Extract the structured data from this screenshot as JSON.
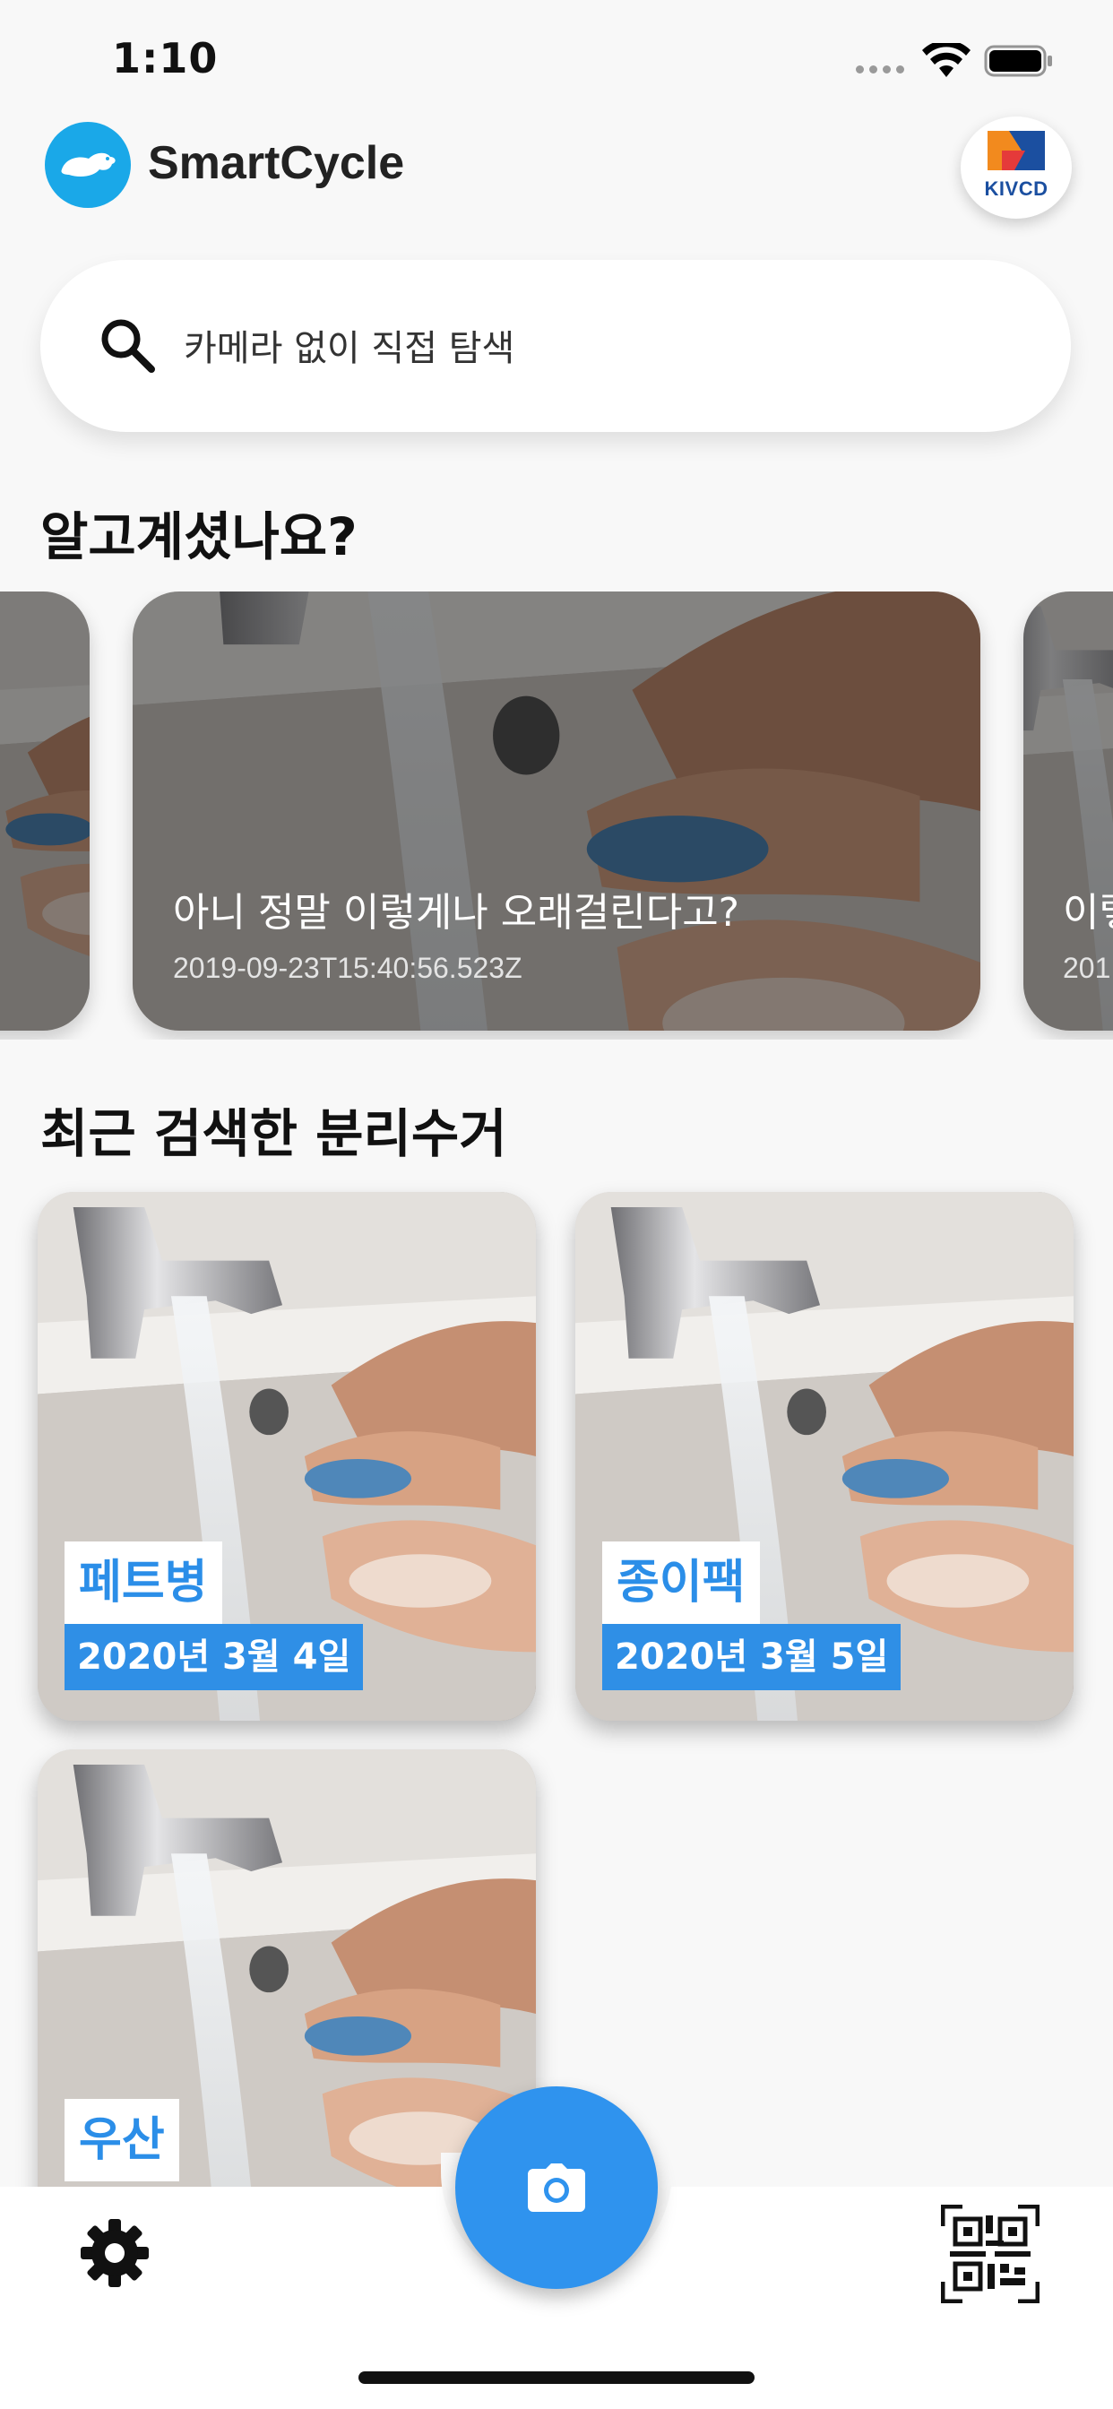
{
  "status_bar": {
    "time": "1:10"
  },
  "header": {
    "app_name": "SmartCycle",
    "partner_logo_text": "KIVCD"
  },
  "search": {
    "placeholder": "카메라 없이 직접 탐색"
  },
  "did_you_know": {
    "title": "알고계셨나요?",
    "cards": [
      {
        "title": "",
        "date": ""
      },
      {
        "title": "아니 정말 이렇게나 오래걸린다고?",
        "date": "2019-09-23T15:40:56.523Z"
      },
      {
        "title": "이렇",
        "date": "201"
      }
    ]
  },
  "recent": {
    "title": "최근 검색한 분리수거",
    "items": [
      {
        "name": "페트병",
        "date": "2020년 3월 4일"
      },
      {
        "name": "종이팩",
        "date": "2020년 3월 5일"
      },
      {
        "name": "우산",
        "date": ""
      }
    ]
  },
  "icons": {
    "settings": "gear-icon",
    "camera": "camera-icon",
    "qr": "qr-code-icon",
    "search": "search-icon"
  },
  "colors": {
    "accent": "#2f93ee",
    "brand": "#1aa8e8"
  }
}
